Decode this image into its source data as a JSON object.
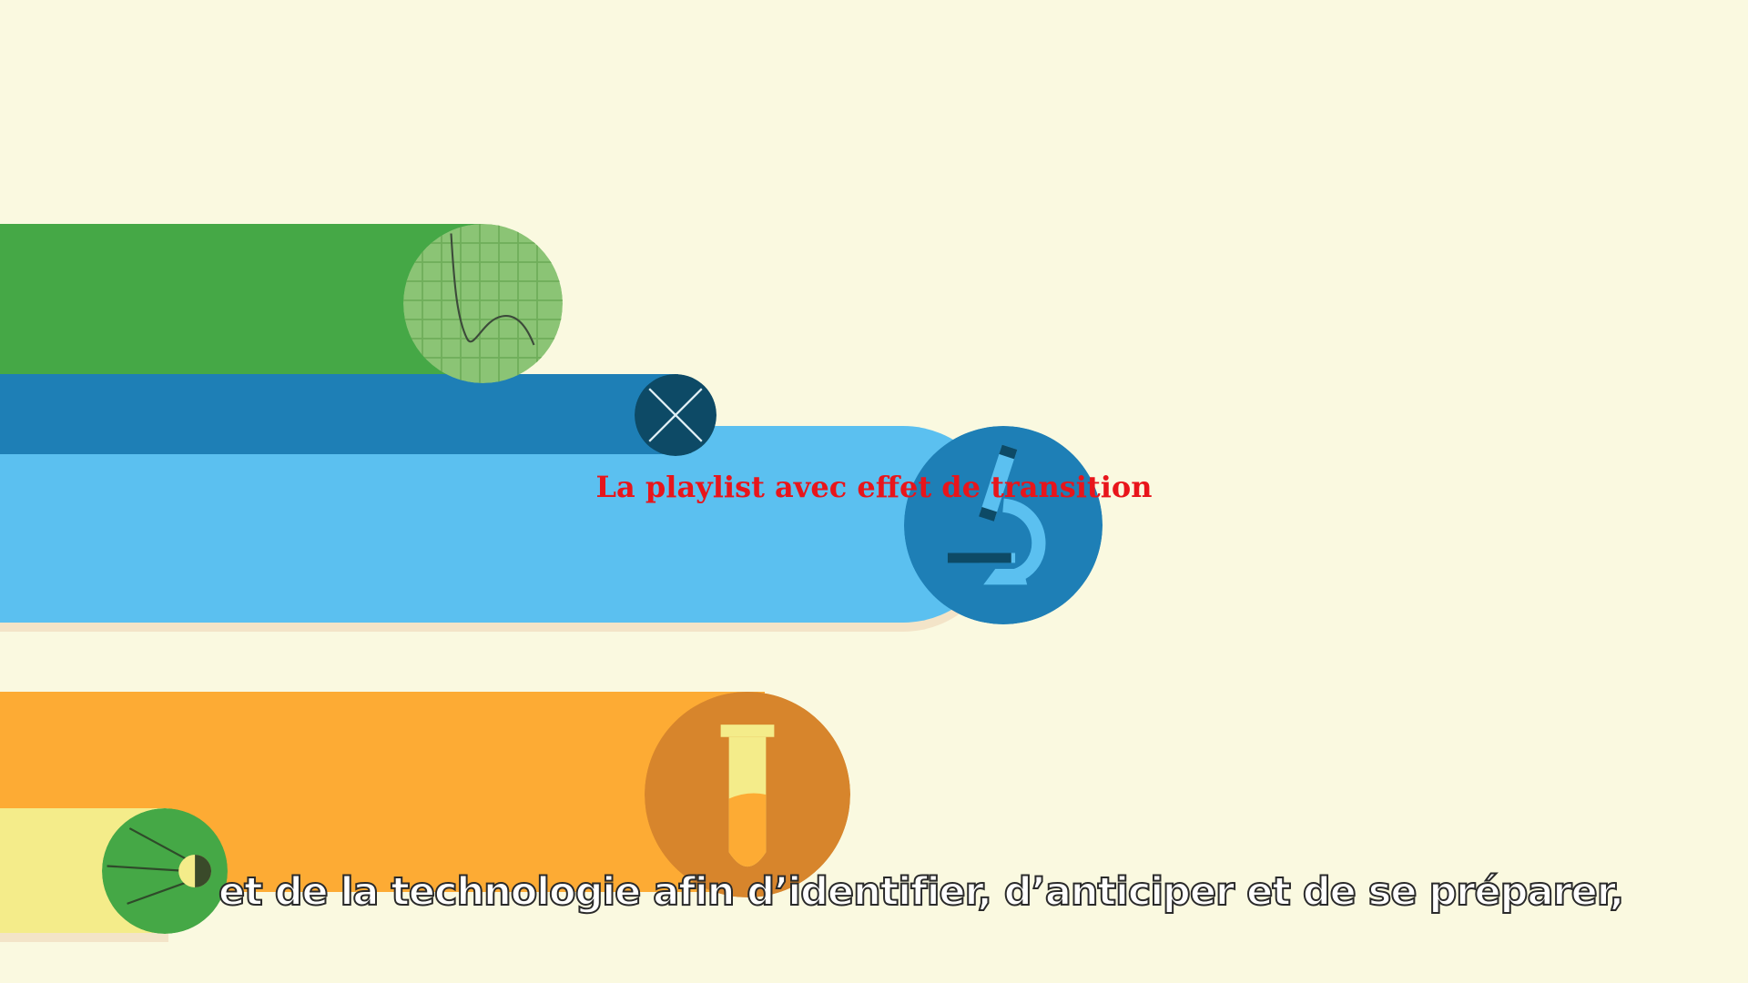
{
  "video": {
    "overlay_title": "La playlist avec effet de transition",
    "subtitle": "et de la technologie afin d’identifier, d’anticiper et de se préparer,"
  },
  "icons": {
    "graph": "graph-paper-icon",
    "cross": "cross-icon",
    "microscope": "microscope-icon",
    "test_tube": "test-tube-icon",
    "satellite": "satellite-icon"
  },
  "colors": {
    "background": "#faf9e0",
    "green": "#45a846",
    "navy": "#1e7fb6",
    "sky": "#5bc0f0",
    "orange": "#fdab34",
    "yellow": "#f4ec8a",
    "title_red": "#e8151b"
  }
}
